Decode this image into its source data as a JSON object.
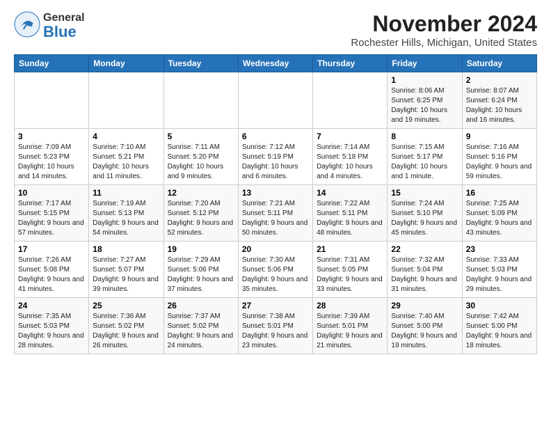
{
  "header": {
    "logo_general": "General",
    "logo_blue": "Blue",
    "title": "November 2024",
    "subtitle": "Rochester Hills, Michigan, United States"
  },
  "days_of_week": [
    "Sunday",
    "Monday",
    "Tuesday",
    "Wednesday",
    "Thursday",
    "Friday",
    "Saturday"
  ],
  "weeks": [
    [
      {
        "day": "",
        "info": ""
      },
      {
        "day": "",
        "info": ""
      },
      {
        "day": "",
        "info": ""
      },
      {
        "day": "",
        "info": ""
      },
      {
        "day": "",
        "info": ""
      },
      {
        "day": "1",
        "info": "Sunrise: 8:06 AM\nSunset: 6:25 PM\nDaylight: 10 hours and 19 minutes."
      },
      {
        "day": "2",
        "info": "Sunrise: 8:07 AM\nSunset: 6:24 PM\nDaylight: 10 hours and 16 minutes."
      }
    ],
    [
      {
        "day": "3",
        "info": "Sunrise: 7:09 AM\nSunset: 5:23 PM\nDaylight: 10 hours and 14 minutes."
      },
      {
        "day": "4",
        "info": "Sunrise: 7:10 AM\nSunset: 5:21 PM\nDaylight: 10 hours and 11 minutes."
      },
      {
        "day": "5",
        "info": "Sunrise: 7:11 AM\nSunset: 5:20 PM\nDaylight: 10 hours and 9 minutes."
      },
      {
        "day": "6",
        "info": "Sunrise: 7:12 AM\nSunset: 5:19 PM\nDaylight: 10 hours and 6 minutes."
      },
      {
        "day": "7",
        "info": "Sunrise: 7:14 AM\nSunset: 5:18 PM\nDaylight: 10 hours and 4 minutes."
      },
      {
        "day": "8",
        "info": "Sunrise: 7:15 AM\nSunset: 5:17 PM\nDaylight: 10 hours and 1 minute."
      },
      {
        "day": "9",
        "info": "Sunrise: 7:16 AM\nSunset: 5:16 PM\nDaylight: 9 hours and 59 minutes."
      }
    ],
    [
      {
        "day": "10",
        "info": "Sunrise: 7:17 AM\nSunset: 5:15 PM\nDaylight: 9 hours and 57 minutes."
      },
      {
        "day": "11",
        "info": "Sunrise: 7:19 AM\nSunset: 5:13 PM\nDaylight: 9 hours and 54 minutes."
      },
      {
        "day": "12",
        "info": "Sunrise: 7:20 AM\nSunset: 5:12 PM\nDaylight: 9 hours and 52 minutes."
      },
      {
        "day": "13",
        "info": "Sunrise: 7:21 AM\nSunset: 5:11 PM\nDaylight: 9 hours and 50 minutes."
      },
      {
        "day": "14",
        "info": "Sunrise: 7:22 AM\nSunset: 5:11 PM\nDaylight: 9 hours and 48 minutes."
      },
      {
        "day": "15",
        "info": "Sunrise: 7:24 AM\nSunset: 5:10 PM\nDaylight: 9 hours and 45 minutes."
      },
      {
        "day": "16",
        "info": "Sunrise: 7:25 AM\nSunset: 5:09 PM\nDaylight: 9 hours and 43 minutes."
      }
    ],
    [
      {
        "day": "17",
        "info": "Sunrise: 7:26 AM\nSunset: 5:08 PM\nDaylight: 9 hours and 41 minutes."
      },
      {
        "day": "18",
        "info": "Sunrise: 7:27 AM\nSunset: 5:07 PM\nDaylight: 9 hours and 39 minutes."
      },
      {
        "day": "19",
        "info": "Sunrise: 7:29 AM\nSunset: 5:06 PM\nDaylight: 9 hours and 37 minutes."
      },
      {
        "day": "20",
        "info": "Sunrise: 7:30 AM\nSunset: 5:06 PM\nDaylight: 9 hours and 35 minutes."
      },
      {
        "day": "21",
        "info": "Sunrise: 7:31 AM\nSunset: 5:05 PM\nDaylight: 9 hours and 33 minutes."
      },
      {
        "day": "22",
        "info": "Sunrise: 7:32 AM\nSunset: 5:04 PM\nDaylight: 9 hours and 31 minutes."
      },
      {
        "day": "23",
        "info": "Sunrise: 7:33 AM\nSunset: 5:03 PM\nDaylight: 9 hours and 29 minutes."
      }
    ],
    [
      {
        "day": "24",
        "info": "Sunrise: 7:35 AM\nSunset: 5:03 PM\nDaylight: 9 hours and 28 minutes."
      },
      {
        "day": "25",
        "info": "Sunrise: 7:36 AM\nSunset: 5:02 PM\nDaylight: 9 hours and 26 minutes."
      },
      {
        "day": "26",
        "info": "Sunrise: 7:37 AM\nSunset: 5:02 PM\nDaylight: 9 hours and 24 minutes."
      },
      {
        "day": "27",
        "info": "Sunrise: 7:38 AM\nSunset: 5:01 PM\nDaylight: 9 hours and 23 minutes."
      },
      {
        "day": "28",
        "info": "Sunrise: 7:39 AM\nSunset: 5:01 PM\nDaylight: 9 hours and 21 minutes."
      },
      {
        "day": "29",
        "info": "Sunrise: 7:40 AM\nSunset: 5:00 PM\nDaylight: 9 hours and 19 minutes."
      },
      {
        "day": "30",
        "info": "Sunrise: 7:42 AM\nSunset: 5:00 PM\nDaylight: 9 hours and 18 minutes."
      }
    ]
  ]
}
